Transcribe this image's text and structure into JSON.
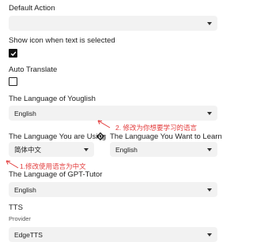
{
  "default_action": {
    "label": "Default Action",
    "value": ""
  },
  "show_icon": {
    "label": "Show icon when text is selected",
    "checked": true
  },
  "auto_translate": {
    "label": "Auto Translate",
    "checked": false
  },
  "youglish_language": {
    "label": "The Language of Youglish",
    "value": "English"
  },
  "language_using": {
    "label": "The Language You are Using",
    "value": "简体中文"
  },
  "language_learn": {
    "label": "The Language You Want to Learn",
    "value": "English"
  },
  "gpt_tutor_language": {
    "label": "The Language of GPT-Tutor",
    "value": "English"
  },
  "tts": {
    "label": "TTS",
    "provider_label": "Provider",
    "provider_value": "EdgeTTS"
  },
  "annotations": {
    "note_1": "1.修改使用语言为中文",
    "note_2": "2. 修改为你想要学习的语言"
  },
  "colors": {
    "annotation": "#e23b3b",
    "field_bg": "#f2f2f2"
  }
}
